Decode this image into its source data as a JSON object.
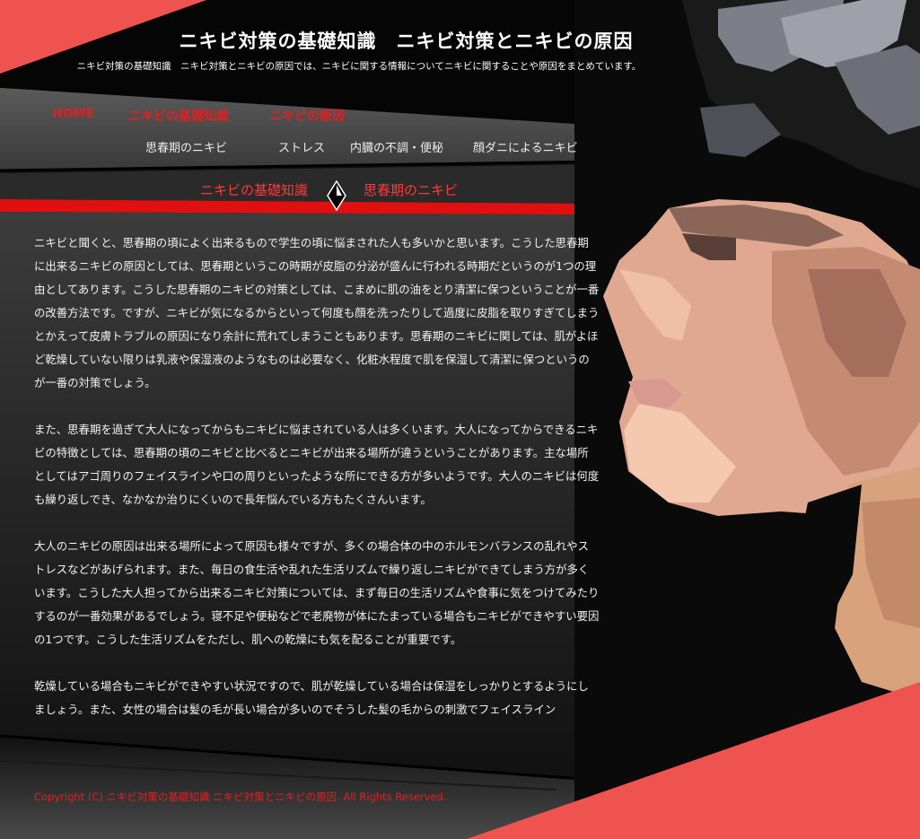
{
  "header": {
    "title": "ニキビ対策の基礎知識　ニキビ対策とニキビの原因",
    "tagline": "ニキビ対策の基礎知識　ニキビ対策とニキビの原因では、ニキビに関する情報についてニキビに関することや原因をまとめています。"
  },
  "nav": {
    "main": [
      "HOME",
      "ニキビの基礎知識",
      "ニキビの原因"
    ],
    "sub": [
      "思春期のニキビ",
      "ストレス",
      "内臓の不調・便秘",
      "顔ダニによるニキビ"
    ]
  },
  "breadcrumb": {
    "parent": "ニキビの基礎知識",
    "current": "思春期のニキビ"
  },
  "content": {
    "paragraphs": [
      "ニキビと聞くと、思春期の頃によく出来るもので学生の頃に悩まされた人も多いかと思います。こうした思春期に出来るニキビの原因としては、思春期というこの時期が皮脂の分泌が盛んに行われる時期だというのが1つの理由としてあります。こうした思春期のニキビの対策としては、こまめに肌の油をとり清潔に保つということが一番の改善方法です。ですが、ニキビが気になるからといって何度も顔を洗ったりして過度に皮脂を取りすぎてしまうとかえって皮膚トラブルの原因になり余計に荒れてしまうこともあります。思春期のニキビに関しては、肌がよほど乾燥していない限りは乳液や保湿液のようなものは必要なく、化粧水程度で肌を保湿して清潔に保つというのが一番の対策でしょう。",
      "また、思春期を過ぎて大人になってからもニキビに悩まされている人は多くいます。大人になってからできるニキビの特徴としては、思春期の頃のニキビと比べるとニキビが出来る場所が違うということがあります。主な場所としてはアゴ周りのフェイスラインや口の周りといったような所にできる方が多いようです。大人のニキビは何度も繰り返しでき、なかなか治りにくいので長年悩んでいる方もたくさんいます。",
      "大人のニキビの原因は出来る場所によって原因も様々ですが、多くの場合体の中のホルモンバランスの乱れやストレスなどがあげられます。また、毎日の食生活や乱れた生活リズムで繰り返しニキビができてしまう方が多くいます。こうした大人担ってから出来るニキビ対策については、まず毎日の生活リズムや食事に気をつけてみたりするのが一番効果があるでしょう。寝不足や便秘などで老廃物が体にたまっている場合もニキビができやすい要因の1つです。こうした生活リズムをただし、肌への乾燥にも気を配ることが重要です。",
      "乾燥している場合もニキビができやすい状況ですので、肌が乾燥している場合は保湿をしっかりとするようにしましょう。また、女性の場合は髪の毛が長い場合が多いのでそうした髪の毛からの刺激でフェイスライン"
    ]
  },
  "footer": {
    "copyright": "Copyright (C)  ニキビ対策の基礎知識  ニキビ対策とニキビの原因.  All Rights Reserved."
  },
  "colors": {
    "accent": "#e02020",
    "coral": "#ef5350",
    "background": "#141414"
  }
}
